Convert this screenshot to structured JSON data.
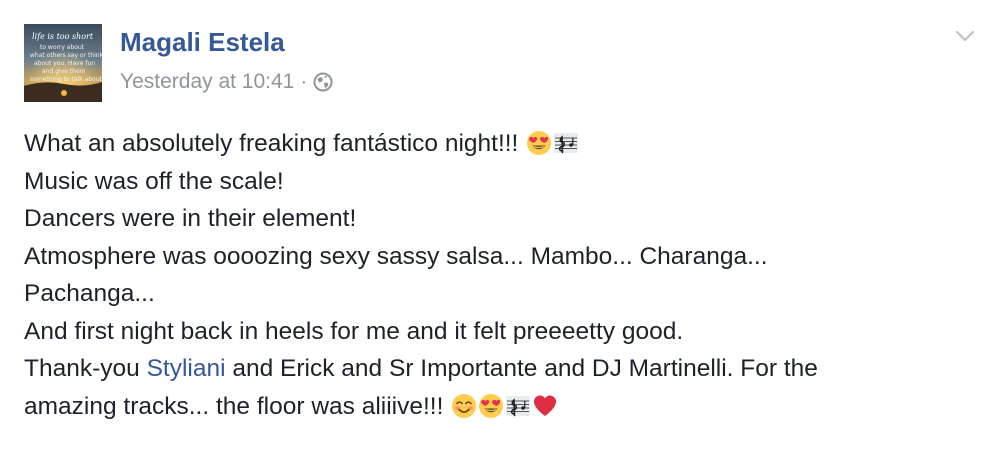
{
  "post": {
    "author_name": "Magali Estela",
    "timestamp": "Yesterday at 10:41",
    "separator": "·",
    "audience_icon": "globe-icon",
    "menu_icon": "chevron-down-icon",
    "avatar": {
      "icon": "avatar-image",
      "lines": [
        "life is too short",
        "to worry about",
        "what others say or think",
        "about you. Have fun",
        "and give them",
        "something to talk about."
      ]
    },
    "body": {
      "line1": "What an absolutely freaking fantástico night!!!",
      "line2": "Music was off the scale!",
      "line3": "Dancers were in their element!",
      "line4": "Atmosphere was oooozing sexy sassy salsa... Mambo... Charanga...",
      "line5": "Pachanga...",
      "line6": "And first night back in heels for me and it felt preeeetty good.",
      "line7_prefix": "Thank-you ",
      "line7_mention": "Styliani",
      "line7_suffix": " and Erick and Sr Importante and DJ Martinelli. For the",
      "line8": "amazing tracks... the floor was aliiive!!!"
    },
    "emojis": {
      "line1": [
        "heart-eyes-emoji-icon",
        "musical-score-emoji-icon"
      ],
      "line8": [
        "smiling-blush-emoji-icon",
        "heart-eyes-emoji-icon",
        "musical-score-emoji-icon",
        "red-heart-emoji-icon"
      ]
    }
  },
  "colors": {
    "author_link": "#365899",
    "meta_text": "#90949c",
    "body_text": "#1d2129",
    "background": "#ffffff"
  }
}
